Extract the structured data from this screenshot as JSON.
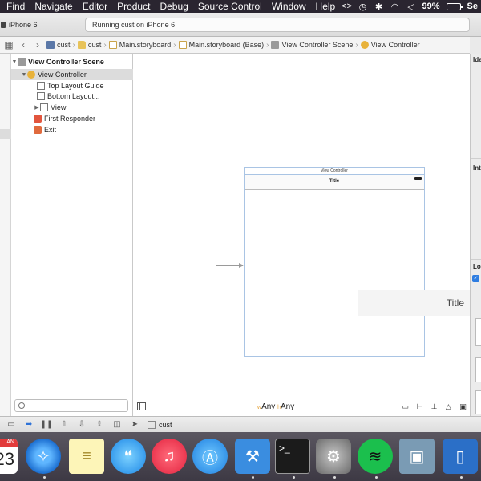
{
  "menubar": {
    "items": [
      "Find",
      "Navigate",
      "Editor",
      "Product",
      "Debug",
      "Source Control",
      "Window",
      "Help"
    ],
    "battery_percent": "99%",
    "clock_partial": "Se"
  },
  "toolbar": {
    "device": "iPhone 6",
    "activity": "Running cust on iPhone 6"
  },
  "jumpbar": {
    "path": [
      "cust",
      "cust",
      "Main.storyboard",
      "Main.storyboard (Base)",
      "View Controller Scene",
      "View Controller"
    ]
  },
  "outline": {
    "scene": "View Controller Scene",
    "view_controller": "View Controller",
    "top_layout_guide": "Top Layout Guide",
    "bottom_layout_guide": "Bottom Layout...",
    "view": "View",
    "first_responder": "First Responder",
    "exit": "Exit"
  },
  "canvas": {
    "scene_dock_title": "View Controller",
    "nav_title": "Title",
    "size_class_w": "w",
    "size_class_w_value": "Any",
    "size_class_h": "h",
    "size_class_h_value": "Any"
  },
  "popover": {
    "title": "Title"
  },
  "inspector": {
    "labels": [
      "Ide",
      "Int",
      "Lo"
    ]
  },
  "debugbar": {
    "target": "cust"
  },
  "dock": {
    "calendar_month": "AN",
    "calendar_day": "23"
  }
}
